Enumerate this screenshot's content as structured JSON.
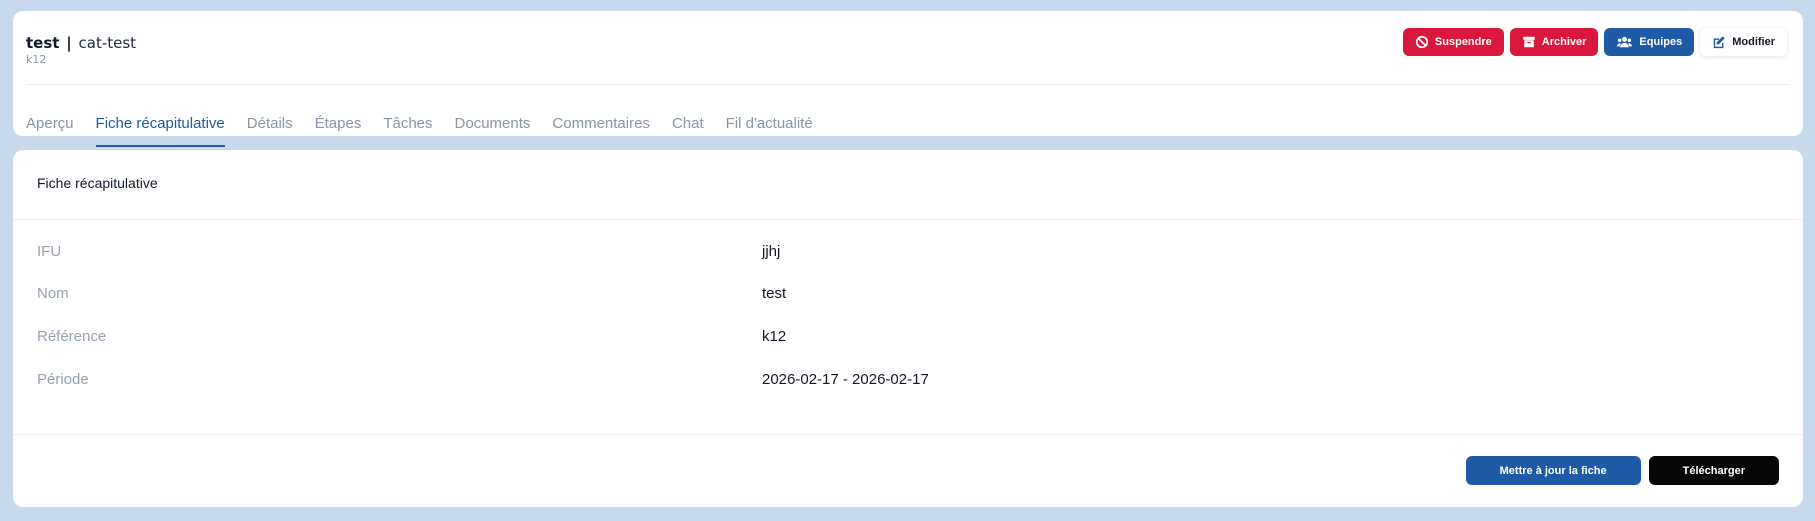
{
  "header": {
    "title_name": "test",
    "title_sep": "|",
    "title_category": "cat-test",
    "subtitle": "k12",
    "actions": [
      {
        "label": "Suspendre",
        "icon": "ban-icon",
        "color": "#d9183b"
      },
      {
        "label": "Archiver",
        "icon": "archive-icon",
        "color": "#d9183b"
      },
      {
        "label": "Equipes",
        "icon": "users-icon",
        "color": "#1f5aa6"
      },
      {
        "label": "Modifier",
        "icon": "edit-icon",
        "color": "#ffffff"
      }
    ]
  },
  "tabs": [
    {
      "label": "Aperçu",
      "active": false
    },
    {
      "label": "Fiche récapitulative",
      "active": true
    },
    {
      "label": "Détails",
      "active": false
    },
    {
      "label": "Étapes",
      "active": false
    },
    {
      "label": "Tâches",
      "active": false
    },
    {
      "label": "Documents",
      "active": false
    },
    {
      "label": "Commentaires",
      "active": false
    },
    {
      "label": "Chat",
      "active": false
    },
    {
      "label": "Fil d'actualité",
      "active": false
    }
  ],
  "summary": {
    "title": "Fiche récapitulative",
    "rows": [
      {
        "label": "IFU",
        "value": "jjhj"
      },
      {
        "label": "Nom",
        "value": "test"
      },
      {
        "label": "Référence",
        "value": "k12"
      },
      {
        "label": "Période",
        "value": "2026-02-17 - 2026-02-17"
      }
    ],
    "update_button": "Mettre à jour la fiche",
    "download_button": "Télécharger"
  },
  "colors": {
    "background": "#c8d9ec",
    "primary": "#1f5aa6",
    "danger": "#d9183b",
    "dark": "#060606"
  }
}
